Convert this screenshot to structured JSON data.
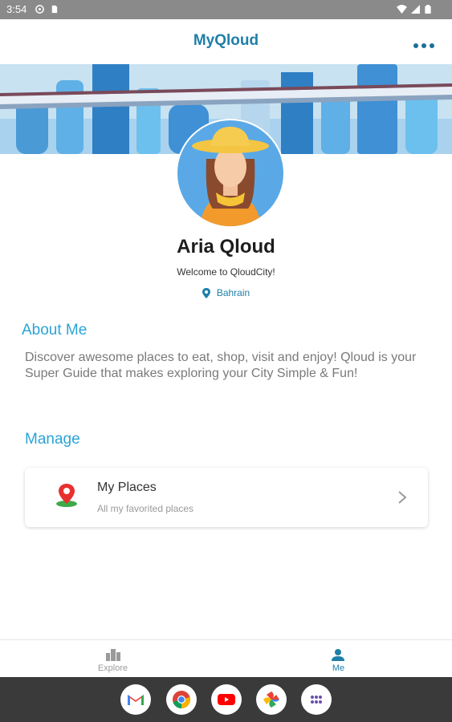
{
  "status_bar": {
    "time": "3:54",
    "icons": [
      "settings-icon",
      "sd-card-icon",
      "wifi-icon",
      "signal-icon",
      "battery-icon"
    ]
  },
  "app_bar": {
    "logo_text": "MyQloud",
    "menu_icon": "more-horizontal-icon"
  },
  "profile": {
    "name": "Aria Qloud",
    "welcome": "Welcome to QloudCity!",
    "location": "Bahrain"
  },
  "about": {
    "title": "About Me",
    "text": "Discover awesome places to eat, shop, visit and enjoy! Qloud is your Super Guide that makes exploring your City Simple & Fun!"
  },
  "manage": {
    "title": "Manage",
    "items": [
      {
        "title": "My Places",
        "subtitle": "All my favorited places",
        "icon": "map-pin-icon"
      }
    ]
  },
  "bottom_nav": {
    "items": [
      {
        "label": "Explore",
        "icon": "city-icon",
        "active": false
      },
      {
        "label": "Me",
        "icon": "person-icon",
        "active": true
      }
    ]
  },
  "dock": {
    "apps": [
      "gmail-icon",
      "chrome-icon",
      "youtube-icon",
      "photos-icon",
      "app-drawer-icon"
    ]
  },
  "colors": {
    "accent": "#2ba4d8",
    "brand": "#1f7fa8",
    "status_bar": "#8a8a8a",
    "dock": "#3a3a3a"
  }
}
